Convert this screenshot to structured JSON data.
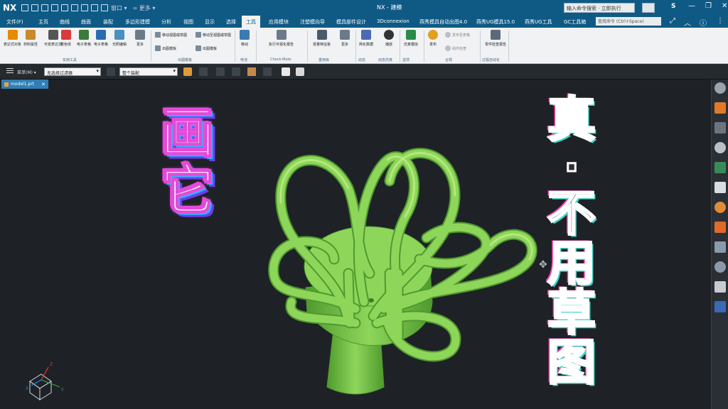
{
  "app": {
    "logo": "NX",
    "window_menu_label": "窗口 ▾",
    "extra_menu_label": "= 更多 ▾",
    "title": "NX - 建模",
    "search_placeholder": "输入命令搜索 · 立即执行",
    "user_initial": "S"
  },
  "menubar": {
    "items": [
      "文件(F)",
      "主页",
      "曲线",
      "曲面",
      "装配",
      "多边形建模",
      "分析",
      "视图",
      "显示",
      "选择",
      "工具",
      "应用模块",
      "注塑模向导",
      "模具部件设计",
      "3Dconnexion",
      "燕秀模具自动出图4.0",
      "燕秀UG模具15.0",
      "燕秀UG工具",
      "GC工具箱"
    ],
    "active": "工具",
    "command_search_placeholder": "查找命令 (Ctrl+Space)"
  },
  "ribbon": {
    "buttons": [
      {
        "label": "表达式对象",
        "color": "#e68a00"
      },
      {
        "label": "材料属性",
        "color": "#c88a2a"
      },
      {
        "label": "可变表达式",
        "color": "#555555"
      },
      {
        "label": "着色体",
        "color": "#d93b3b"
      },
      {
        "label": "电子表格",
        "color": "#3a7a3a"
      },
      {
        "label": "电子表格",
        "color": "#2a6bb0"
      },
      {
        "label": "光照编辑",
        "color": "#4a90c2"
      },
      {
        "label": "更多",
        "color": "#6a7a88"
      },
      {
        "label": "移动",
        "color": "#3a7ab5"
      },
      {
        "label": "执行可视化报告",
        "color": "#6a7a88"
      },
      {
        "label": "变量特征板",
        "color": "#4a5a6a"
      },
      {
        "label": "更多",
        "color": "#6a7a88"
      },
      {
        "label": "简化数据",
        "color": "#4a6ab5"
      },
      {
        "label": "播放",
        "color": "#333333"
      },
      {
        "label": "仿真模拟",
        "color": "#2a8a4a"
      },
      {
        "label": "发布",
        "color": "#e0a020"
      },
      {
        "label": "零件检查报告",
        "color": "#5a6a7a"
      }
    ],
    "small_buttons": [
      "移动视图或草图",
      "移动至视图或草图",
      "出图模板",
      "出图模板"
    ],
    "disabled_buttons": [
      "发布至表格",
      "组件检查"
    ],
    "groups": [
      "实用工具",
      "出图模板",
      "电池",
      "Check-Mate",
      "重用库",
      "动态",
      "动态仿真",
      "选项",
      "合规",
      "数据集",
      "过程自动化"
    ],
    "group_label_check": "Check-Mate"
  },
  "selection_bar": {
    "filter_label": "菜单(M) ▾",
    "type_filter": "无选择过滤器",
    "scope": "整个装配"
  },
  "doc_tab": {
    "name": "model1.prt",
    "close": "✕"
  },
  "overlay": {
    "left_text": [
      "画",
      "它"
    ],
    "right_text": [
      "真",
      "·",
      "不",
      "用",
      "草",
      "图"
    ]
  },
  "model": {
    "color": "#8ed65a",
    "shade_color": "#4f9a2f",
    "highlight_color": "#c6f08a"
  },
  "triad_labels": {
    "x": "X",
    "y": "Y",
    "z": "Z"
  },
  "right_toolbar_icons": [
    "gear-icon",
    "view-cube-icon",
    "resource-icon",
    "part-icon",
    "toolbar-icon",
    "roles-icon",
    "history-icon",
    "process-icon",
    "web-icon",
    "palette-icon",
    "material-icon",
    "library-icon"
  ]
}
